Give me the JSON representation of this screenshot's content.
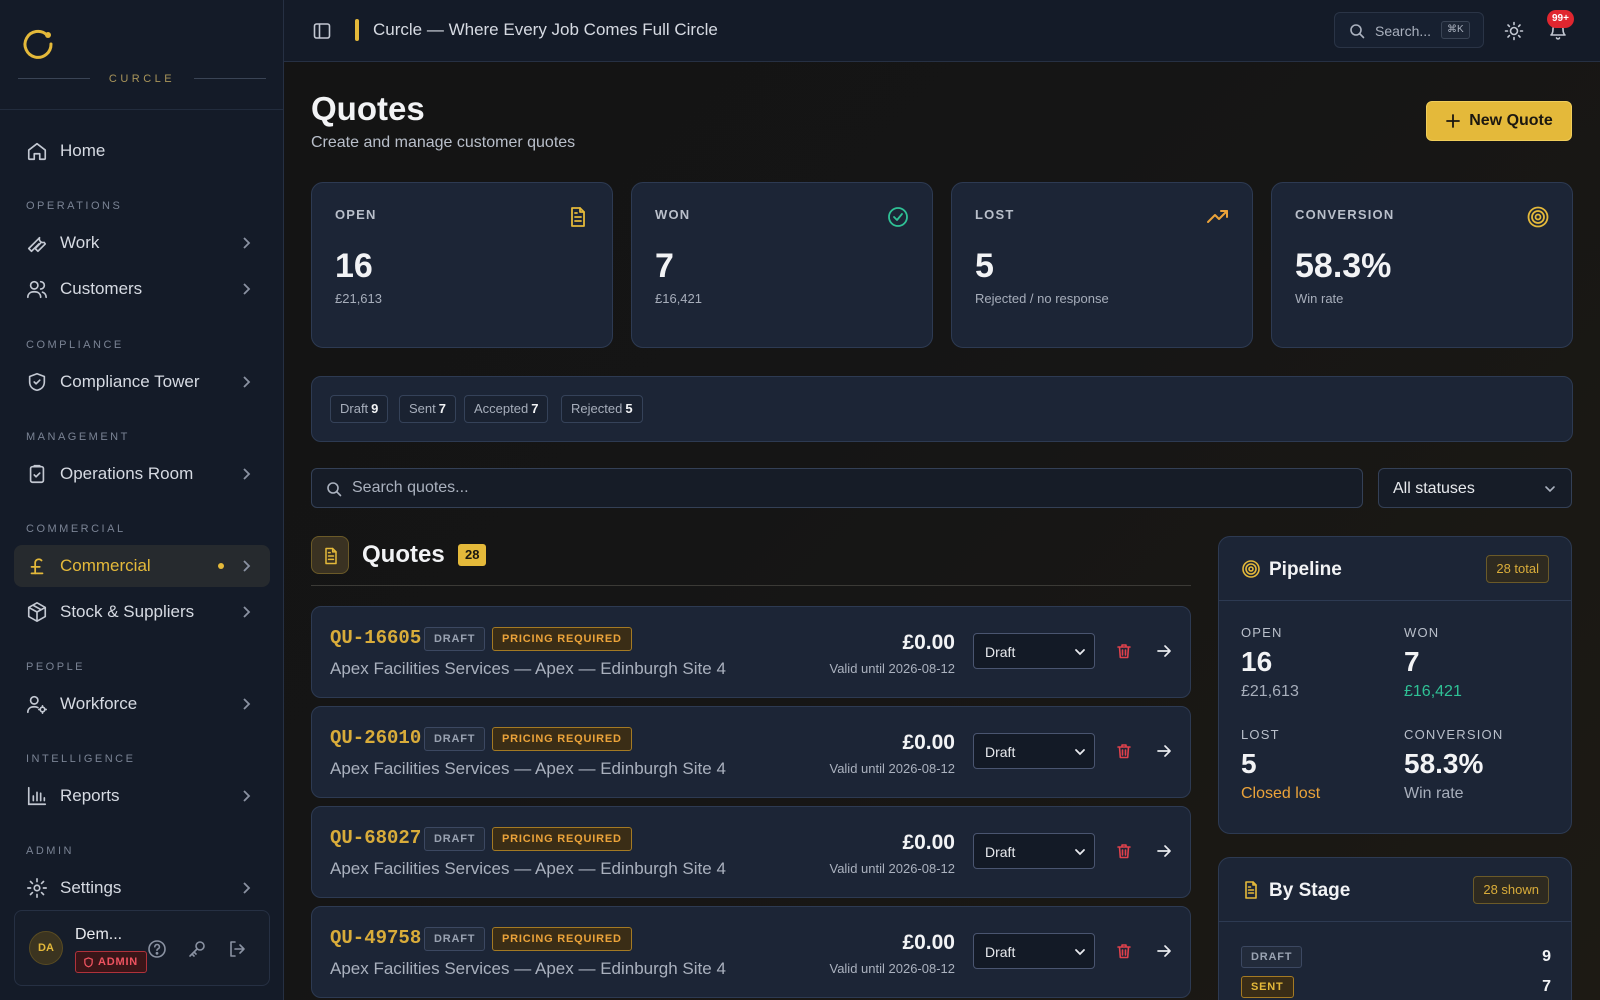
{
  "brand": {
    "name": "CURCLE"
  },
  "sidebar": {
    "home": "Home",
    "sections": [
      {
        "label": "OPERATIONS"
      },
      {
        "label": "COMPLIANCE"
      },
      {
        "label": "MANAGEMENT"
      },
      {
        "label": "COMMERCIAL"
      },
      {
        "label": "PEOPLE"
      },
      {
        "label": "INTELLIGENCE"
      },
      {
        "label": "ADMIN"
      }
    ],
    "items": [
      {
        "label": "Work",
        "icon": "wrench-icon"
      },
      {
        "label": "Customers",
        "icon": "users-icon"
      },
      {
        "label": "Compliance Tower",
        "icon": "shield-check-icon"
      },
      {
        "label": "Operations Room",
        "icon": "clipboard-check-icon"
      },
      {
        "label": "Commercial",
        "icon": "pound-icon",
        "active": true
      },
      {
        "label": "Stock & Suppliers",
        "icon": "package-icon"
      },
      {
        "label": "Workforce",
        "icon": "user-cog-icon"
      },
      {
        "label": "Reports",
        "icon": "bar-chart-icon"
      },
      {
        "label": "Settings",
        "icon": "gear-icon"
      }
    ],
    "user": {
      "initials": "DA",
      "name": "Dem...",
      "role": "ADMIN"
    }
  },
  "topbar": {
    "title": "Curcle — Where Every Job Comes Full Circle",
    "search_label": "Search...",
    "shortcut": "⌘K",
    "notifications": "99+"
  },
  "page": {
    "title": "Quotes",
    "subtitle": "Create and manage customer quotes",
    "new_button": "New Quote"
  },
  "stats": [
    {
      "label": "OPEN",
      "value": "16",
      "sub": "£21,613",
      "icon": "document-icon",
      "color": "#e4b93a"
    },
    {
      "label": "WON",
      "value": "7",
      "sub": "£16,421",
      "icon": "check-circle-icon",
      "color": "#2fc195"
    },
    {
      "label": "LOST",
      "value": "5",
      "sub": "Rejected / no response",
      "icon": "trending-up-icon",
      "color": "#eba33a"
    },
    {
      "label": "CONVERSION",
      "value": "58.3%",
      "sub": "Win rate",
      "icon": "target-icon",
      "color": "#e4b93a"
    }
  ],
  "status_chips": [
    {
      "label": "Draft",
      "count": "9"
    },
    {
      "label": "Sent",
      "count": "7"
    },
    {
      "label": "Accepted",
      "count": "7"
    },
    {
      "label": "Rejected",
      "count": "5"
    }
  ],
  "filters": {
    "search_placeholder": "Search quotes...",
    "status_value": "All statuses"
  },
  "quotes_section": {
    "title": "Quotes",
    "count": "28"
  },
  "quotes": [
    {
      "id": "QU-16605",
      "status_badge": "DRAFT",
      "flag": "PRICING REQUIRED",
      "customer": "Apex Facilities Services — Apex — Edinburgh Site 4",
      "amount": "£0.00",
      "valid": "Valid until 2026-08-12",
      "status": "Draft"
    },
    {
      "id": "QU-26010",
      "status_badge": "DRAFT",
      "flag": "PRICING REQUIRED",
      "customer": "Apex Facilities Services — Apex — Edinburgh Site 4",
      "amount": "£0.00",
      "valid": "Valid until 2026-08-12",
      "status": "Draft"
    },
    {
      "id": "QU-68027",
      "status_badge": "DRAFT",
      "flag": "PRICING REQUIRED",
      "customer": "Apex Facilities Services — Apex — Edinburgh Site 4",
      "amount": "£0.00",
      "valid": "Valid until 2026-08-12",
      "status": "Draft"
    },
    {
      "id": "QU-49758",
      "status_badge": "DRAFT",
      "flag": "PRICING REQUIRED",
      "customer": "Apex Facilities Services — Apex — Edinburgh Site 4",
      "amount": "£0.00",
      "valid": "Valid until 2026-08-12",
      "status": "Draft"
    }
  ],
  "pipeline": {
    "title": "Pipeline",
    "badge": "28 total",
    "metrics": [
      {
        "label": "OPEN",
        "value": "16",
        "sub": "£21,613",
        "sub_color": "#a7aebb"
      },
      {
        "label": "WON",
        "value": "7",
        "sub": "£16,421",
        "sub_color": "#2fc195"
      },
      {
        "label": "LOST",
        "value": "5",
        "sub": "Closed lost",
        "sub_color": "#eba33a"
      },
      {
        "label": "CONVERSION",
        "value": "58.3%",
        "sub": "Win rate",
        "sub_color": "#a7aebb"
      }
    ]
  },
  "by_stage": {
    "title": "By Stage",
    "badge": "28 shown",
    "rows": [
      {
        "label": "DRAFT",
        "count": "9"
      },
      {
        "label": "SENT",
        "count": "7"
      }
    ]
  },
  "colors": {
    "accent": "#e4b93a",
    "danger": "#e0414c",
    "success": "#2fc195",
    "warning": "#eba33a"
  }
}
